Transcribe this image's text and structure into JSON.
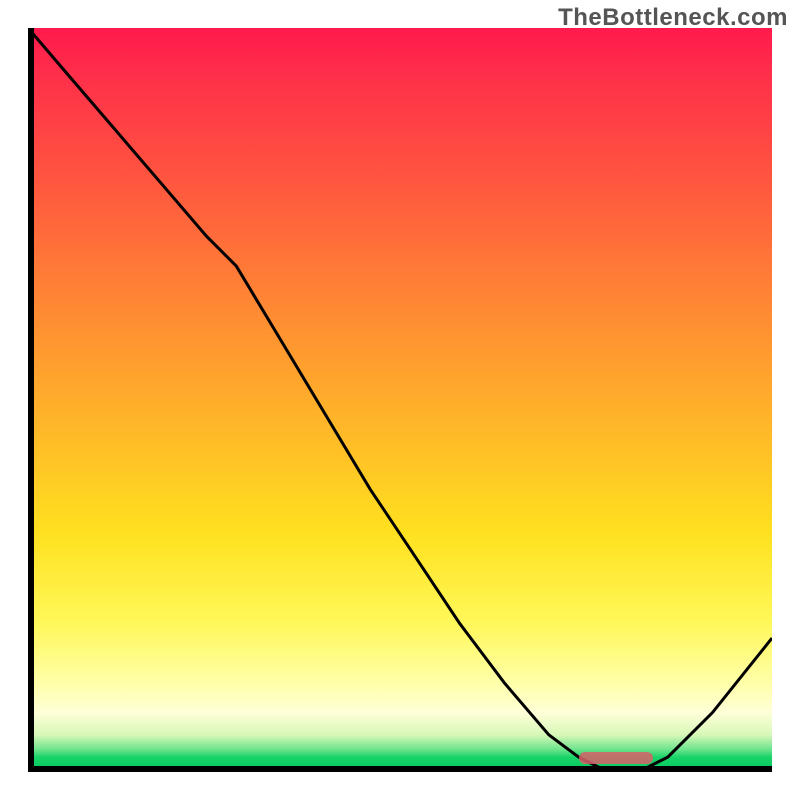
{
  "watermark": "TheBottleneck.com",
  "chart_data": {
    "type": "line",
    "title": "",
    "xlabel": "",
    "ylabel": "",
    "xlim": [
      0,
      100
    ],
    "ylim": [
      0,
      100
    ],
    "grid": false,
    "legend": false,
    "background_gradient": {
      "orientation": "vertical",
      "stops": [
        {
          "pos": 0,
          "color": "#ff1a4d"
        },
        {
          "pos": 22,
          "color": "#ff5a3e"
        },
        {
          "pos": 54,
          "color": "#ffb828"
        },
        {
          "pos": 80,
          "color": "#fff85a"
        },
        {
          "pos": 92,
          "color": "#ffffd8"
        },
        {
          "pos": 100,
          "color": "#00c95e"
        }
      ]
    },
    "series": [
      {
        "name": "curve",
        "x": [
          0,
          6,
          12,
          18,
          24,
          28,
          34,
          40,
          46,
          52,
          58,
          64,
          70,
          74,
          78,
          82,
          86,
          92,
          100
        ],
        "y": [
          100,
          93,
          86,
          79,
          72,
          68,
          58,
          48,
          38,
          29,
          20,
          12,
          5,
          2,
          0,
          0,
          2,
          8,
          18
        ]
      }
    ],
    "minimum_marker": {
      "x_start": 74,
      "x_end": 84,
      "y": 0,
      "color": "#d9606a"
    }
  }
}
